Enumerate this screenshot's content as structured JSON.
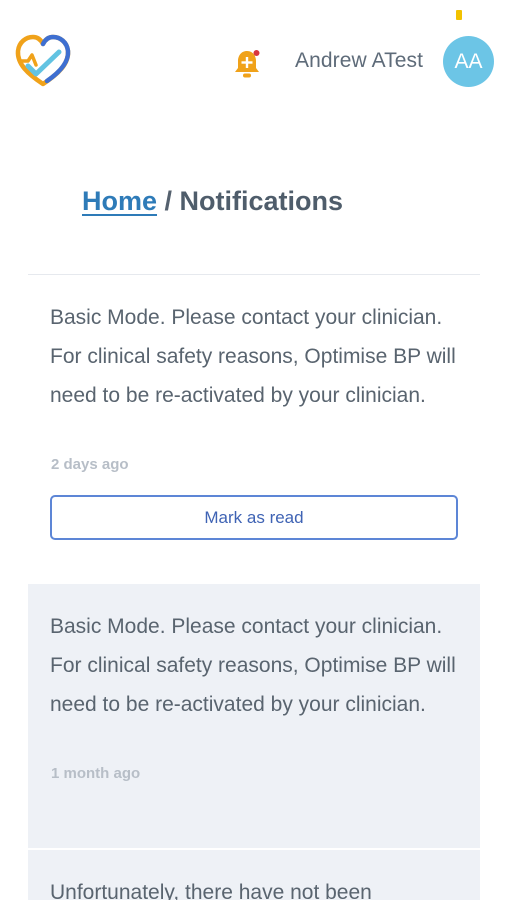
{
  "app": {
    "logo_icon": "heart-check-logo-icon",
    "status_indicator_color": "#f2c200"
  },
  "header": {
    "bell_icon": "bell-plus-icon",
    "user_name": "Andrew ATest",
    "avatar_initials": "AA",
    "avatar_color": "#6cc5e6"
  },
  "breadcrumb": {
    "home_label": "Home",
    "separator": " / ",
    "current_label": "Notifications"
  },
  "notifications": [
    {
      "text": "Basic Mode. Please contact your clinician. For clinical safety reasons, Optimise BP will need to be re-activated by your clinician.",
      "time": "2 days ago",
      "action_label": "Mark as read",
      "read": false
    },
    {
      "text": "Basic Mode. Please contact your clinician. For clinical safety reasons, Optimise BP will need to be re-activated by your clinician.",
      "time": "1 month ago",
      "read": true
    },
    {
      "text": "Unfortunately, there have not been",
      "read": true
    }
  ],
  "colors": {
    "accent": "#2e7bb8",
    "button_border": "#5d86d6",
    "read_background": "#eef1f6",
    "bell": "#f0a21a"
  }
}
